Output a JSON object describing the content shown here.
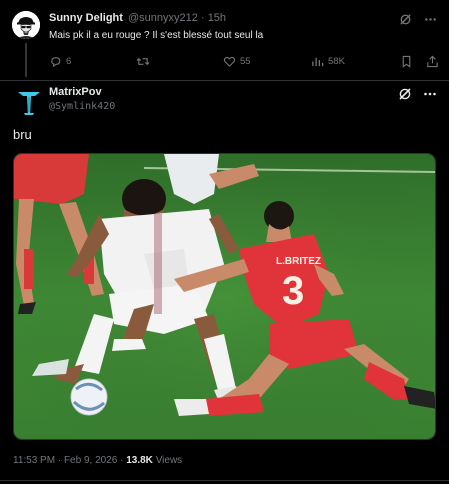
{
  "reply_tweet": {
    "author_name": "Sunny Delight",
    "author_handle": "@sunnyxy212",
    "separator": "·",
    "time": "15h",
    "text": "Mais pk il a eu rouge ? Il s'est blessé tout seul la",
    "replies": "6",
    "reposts": "",
    "likes": "55",
    "views": "58K"
  },
  "main_tweet": {
    "author_name": "MatrixPov",
    "author_handle": "@Symlink420",
    "text": "bru",
    "timestamp": "11:53 PM · Feb 9, 2026 ·",
    "views_count": "13.8K",
    "views_label": "Views"
  },
  "colors": {
    "background": "#000000",
    "text_primary": "#e7e9ea",
    "text_secondary": "#71767b",
    "border": "#2f3336",
    "pitch_green": "#3f8a35",
    "kit_red": "#e0343a"
  }
}
